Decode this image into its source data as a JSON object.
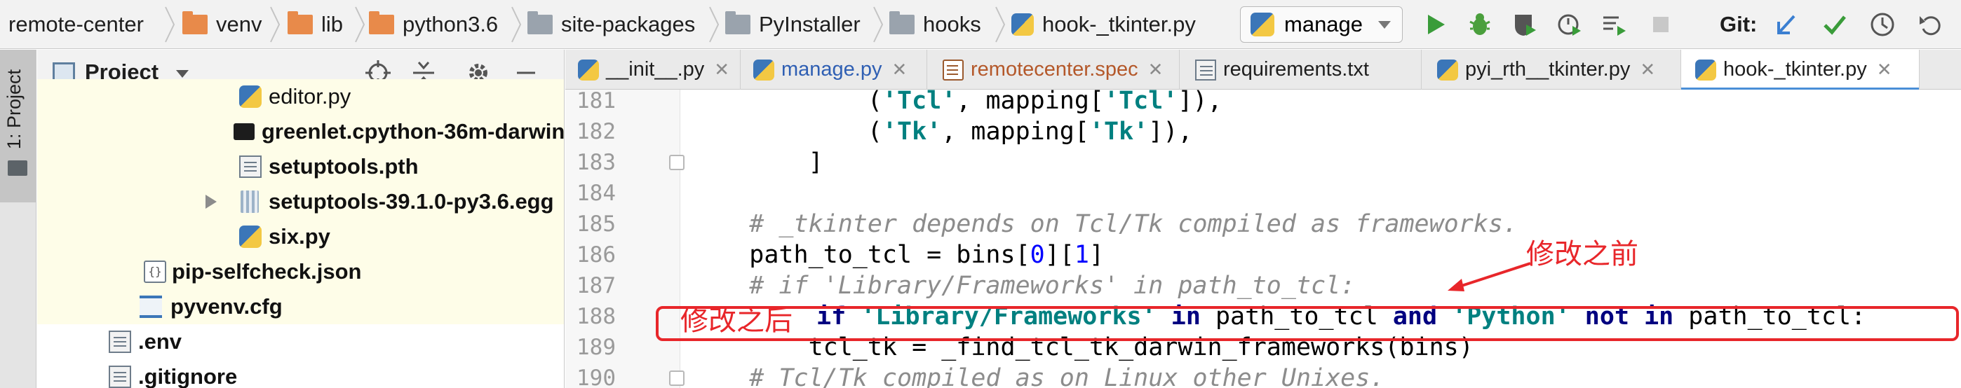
{
  "breadcrumbs": [
    {
      "label": "remote-center",
      "icon": "none"
    },
    {
      "label": "venv",
      "icon": "folder-orange-icon"
    },
    {
      "label": "lib",
      "icon": "folder-orange-icon"
    },
    {
      "label": "python3.6",
      "icon": "folder-orange-icon"
    },
    {
      "label": "site-packages",
      "icon": "folder-gray-icon"
    },
    {
      "label": "PyInstaller",
      "icon": "folder-gray-icon"
    },
    {
      "label": "hooks",
      "icon": "folder-gray-icon"
    },
    {
      "label": "hook-_tkinter.py",
      "icon": "python-file-icon"
    }
  ],
  "toolbar": {
    "run_config": "manage",
    "icons": [
      "run-icon",
      "debug-icon",
      "coverage-icon",
      "profile-icon",
      "concurrency-icon",
      "stop-icon"
    ],
    "git_label": "Git:",
    "git_icons": [
      "git-update-icon",
      "git-commit-icon",
      "git-history-icon",
      "git-rollback-icon"
    ]
  },
  "left_strip": {
    "tab_label": "1: Project"
  },
  "project_panel": {
    "title": "Project",
    "header_icons": [
      "locate-icon",
      "collapse-all-icon",
      "settings-gear-icon",
      "hide-icon"
    ],
    "tree": [
      {
        "label": "editor.py",
        "icon": "python-file-icon",
        "highlight": true,
        "expandable": false
      },
      {
        "label": "greenlet.cpython-36m-darwin.so",
        "icon": "binary-file-icon",
        "highlight": true,
        "expandable": false
      },
      {
        "label": "setuptools.pth",
        "icon": "text-file-icon",
        "highlight": true,
        "expandable": false
      },
      {
        "label": "setuptools-39.1.0-py3.6.egg",
        "icon": "egg-archive-icon",
        "highlight": true,
        "expandable": true
      },
      {
        "label": "six.py",
        "icon": "python-file-icon",
        "highlight": true,
        "expandable": false
      },
      {
        "label": "pip-selfcheck.json",
        "icon": "json-file-icon",
        "highlight": true,
        "expandable": false
      },
      {
        "label": "pyvenv.cfg",
        "icon": "config-file-icon",
        "highlight": true,
        "expandable": false
      },
      {
        "label": ".env",
        "icon": "text-file-icon",
        "highlight": false,
        "expandable": false
      },
      {
        "label": ".gitignore",
        "icon": "text-file-icon",
        "highlight": false,
        "expandable": false
      }
    ]
  },
  "editor_tabs": [
    {
      "label": "__init__.py",
      "icon": "python-file-icon",
      "color": "#1e1e1e",
      "active": false
    },
    {
      "label": "manage.py",
      "icon": "python-file-icon",
      "color": "#2f5fb3",
      "active": false
    },
    {
      "label": "remotecenter.spec",
      "icon": "spec-file-icon",
      "color": "#b4582a",
      "active": false
    },
    {
      "label": "requirements.txt",
      "icon": "text-file-icon",
      "color": "#1e1e1e",
      "active": false
    },
    {
      "label": "pyi_rth__tkinter.py",
      "icon": "python-file-icon",
      "color": "#1e1e1e",
      "active": false
    },
    {
      "label": "hook-_tkinter.py",
      "icon": "python-file-icon",
      "color": "#1e1e1e",
      "active": true
    }
  ],
  "code": {
    "lines": [
      {
        "num": "181",
        "tokens": [
          {
            "t": "            (",
            "c": ""
          },
          {
            "t": "'Tcl'",
            "c": "str"
          },
          {
            "t": ", mapping[",
            "c": ""
          },
          {
            "t": "'Tcl'",
            "c": "str"
          },
          {
            "t": "]),",
            "c": ""
          }
        ]
      },
      {
        "num": "182",
        "tokens": [
          {
            "t": "            (",
            "c": ""
          },
          {
            "t": "'Tk'",
            "c": "str"
          },
          {
            "t": ", mapping[",
            "c": ""
          },
          {
            "t": "'Tk'",
            "c": "str"
          },
          {
            "t": "]),",
            "c": ""
          }
        ]
      },
      {
        "num": "183",
        "tokens": [
          {
            "t": "        ]",
            "c": ""
          }
        ]
      },
      {
        "num": "184",
        "tokens": []
      },
      {
        "num": "185",
        "tokens": [
          {
            "t": "    # _tkinter depends on Tcl/Tk compiled as frameworks.",
            "c": "cmt"
          }
        ]
      },
      {
        "num": "186",
        "tokens": [
          {
            "t": "    path_to_tcl = bins[",
            "c": ""
          },
          {
            "t": "0",
            "c": "num"
          },
          {
            "t": "][",
            "c": ""
          },
          {
            "t": "1",
            "c": "num"
          },
          {
            "t": "]",
            "c": ""
          }
        ]
      },
      {
        "num": "187",
        "tokens": [
          {
            "t": "    # if 'Library/Frameworks' in path_to_tcl:",
            "c": "cmt"
          }
        ]
      },
      {
        "num": "188",
        "tokens": [
          {
            "t": "if",
            "c": "kw"
          },
          {
            "t": " ",
            "c": ""
          },
          {
            "t": "'Library/Frameworks'",
            "c": "str"
          },
          {
            "t": " ",
            "c": ""
          },
          {
            "t": "in",
            "c": "kw"
          },
          {
            "t": " path_to_tcl ",
            "c": ""
          },
          {
            "t": "and",
            "c": "kw"
          },
          {
            "t": " ",
            "c": ""
          },
          {
            "t": "'Python'",
            "c": "str"
          },
          {
            "t": " ",
            "c": ""
          },
          {
            "t": "not in",
            "c": "kw"
          },
          {
            "t": " path_to_tcl:",
            "c": ""
          }
        ]
      },
      {
        "num": "189",
        "tokens": [
          {
            "t": "        tcl_tk = _find_tcl_tk_darwin_frameworks(bins)",
            "c": ""
          }
        ]
      },
      {
        "num": "190",
        "tokens": [
          {
            "t": "    # Tcl/Tk compiled as on Linux other Unixes.",
            "c": "cmt"
          }
        ]
      }
    ]
  },
  "annotations": {
    "before_label": "修改之前",
    "after_label": "修改之后",
    "color": "#e8262a"
  }
}
